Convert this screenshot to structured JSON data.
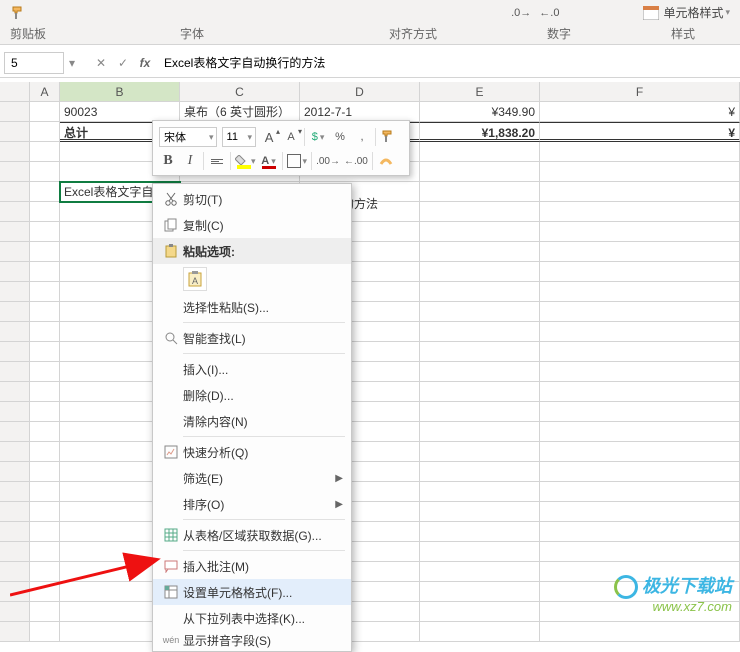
{
  "ribbon": {
    "clipboard_label": "剪贴板",
    "font_label": "字体",
    "align_label": "对齐方式",
    "number_label": "数字",
    "style_label": "样式",
    "cell_styles": "单元格样式"
  },
  "formula_bar": {
    "name_box": "5",
    "cancel": "✕",
    "confirm": "✓",
    "fx": "fx",
    "formula": "Excel表格文字自动换行的方法"
  },
  "columns": [
    "A",
    "B",
    "C",
    "D",
    "E",
    "F"
  ],
  "r1": {
    "b": "90023",
    "c": "桌布（6 英寸圆形）",
    "d": "2012-7-1",
    "e": "¥349.90",
    "f": "¥"
  },
  "r2": {
    "b": "总计",
    "e": "¥1,838.20",
    "f": "¥"
  },
  "cell_text": "Excel表格文字自",
  "trail": "的方法",
  "mini": {
    "font": "宋体",
    "size": "11",
    "grow": "A",
    "shrink": "A",
    "pct": "%",
    "comma": ",",
    "B": "B",
    "I": "I"
  },
  "ctx": {
    "cut": "剪切(T)",
    "copy": "复制(C)",
    "paste_opts": "粘贴选项:",
    "paste_special": "选择性粘贴(S)...",
    "smart_lookup": "智能查找(L)",
    "insert": "插入(I)...",
    "delete": "删除(D)...",
    "clear": "清除内容(N)",
    "quick": "快速分析(Q)",
    "filter": "筛选(E)",
    "sort": "排序(O)",
    "table_range": "从表格/区域获取数据(G)...",
    "insert_comment": "插入批注(M)",
    "format_cells": "设置单元格格式(F)...",
    "dropdown_pick": "从下拉列表中选择(K)...",
    "pinyin": "显示拼音字段(S)"
  },
  "watermark": {
    "brand": "极光下载站",
    "url": "www.xz7.com"
  }
}
